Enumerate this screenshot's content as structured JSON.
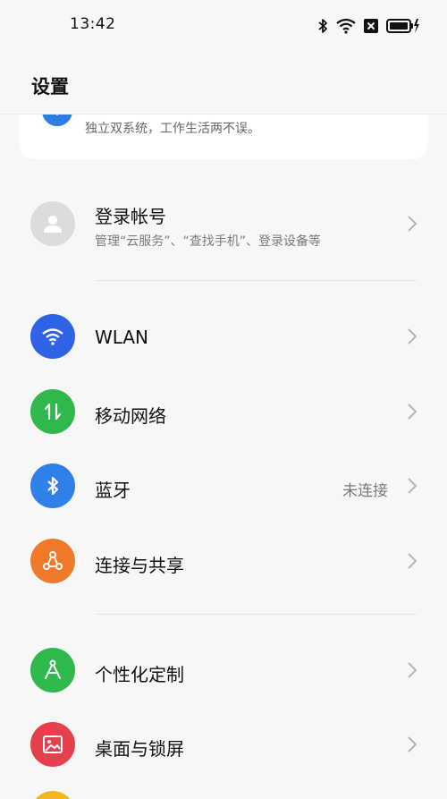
{
  "status_bar": {
    "time": "13:42",
    "icons": [
      "bluetooth-icon",
      "wifi-icon",
      "sim-off-icon",
      "battery-charging-icon"
    ]
  },
  "header": {
    "title": "设置"
  },
  "promo": {
    "text": "独立双系统，工作生活两不误。",
    "icon": "dual-system-icon",
    "icon_color": "#2f7de1"
  },
  "account": {
    "title": "登录帐号",
    "subtitle": "管理“云服务”、“查找手机”、登录设备等",
    "icon": "person-avatar-icon"
  },
  "network_section": [
    {
      "label": "WLAN",
      "icon": "wifi-icon",
      "color": "#2f63e6",
      "value": ""
    },
    {
      "label": "移动网络",
      "icon": "mobile-data-icon",
      "color": "#2fb94d",
      "value": ""
    },
    {
      "label": "蓝牙",
      "icon": "bluetooth-icon",
      "color": "#2f80e8",
      "value": "未连接"
    },
    {
      "label": "连接与共享",
      "icon": "share-icon",
      "color": "#f07a2a",
      "value": ""
    }
  ],
  "personal_section": [
    {
      "label": "个性化定制",
      "icon": "compass-icon",
      "color": "#2fb94d"
    },
    {
      "label": "桌面与锁屏",
      "icon": "picture-icon",
      "color": "#e5404c"
    }
  ],
  "partial_row": {
    "icon_color": "#f2b623"
  }
}
